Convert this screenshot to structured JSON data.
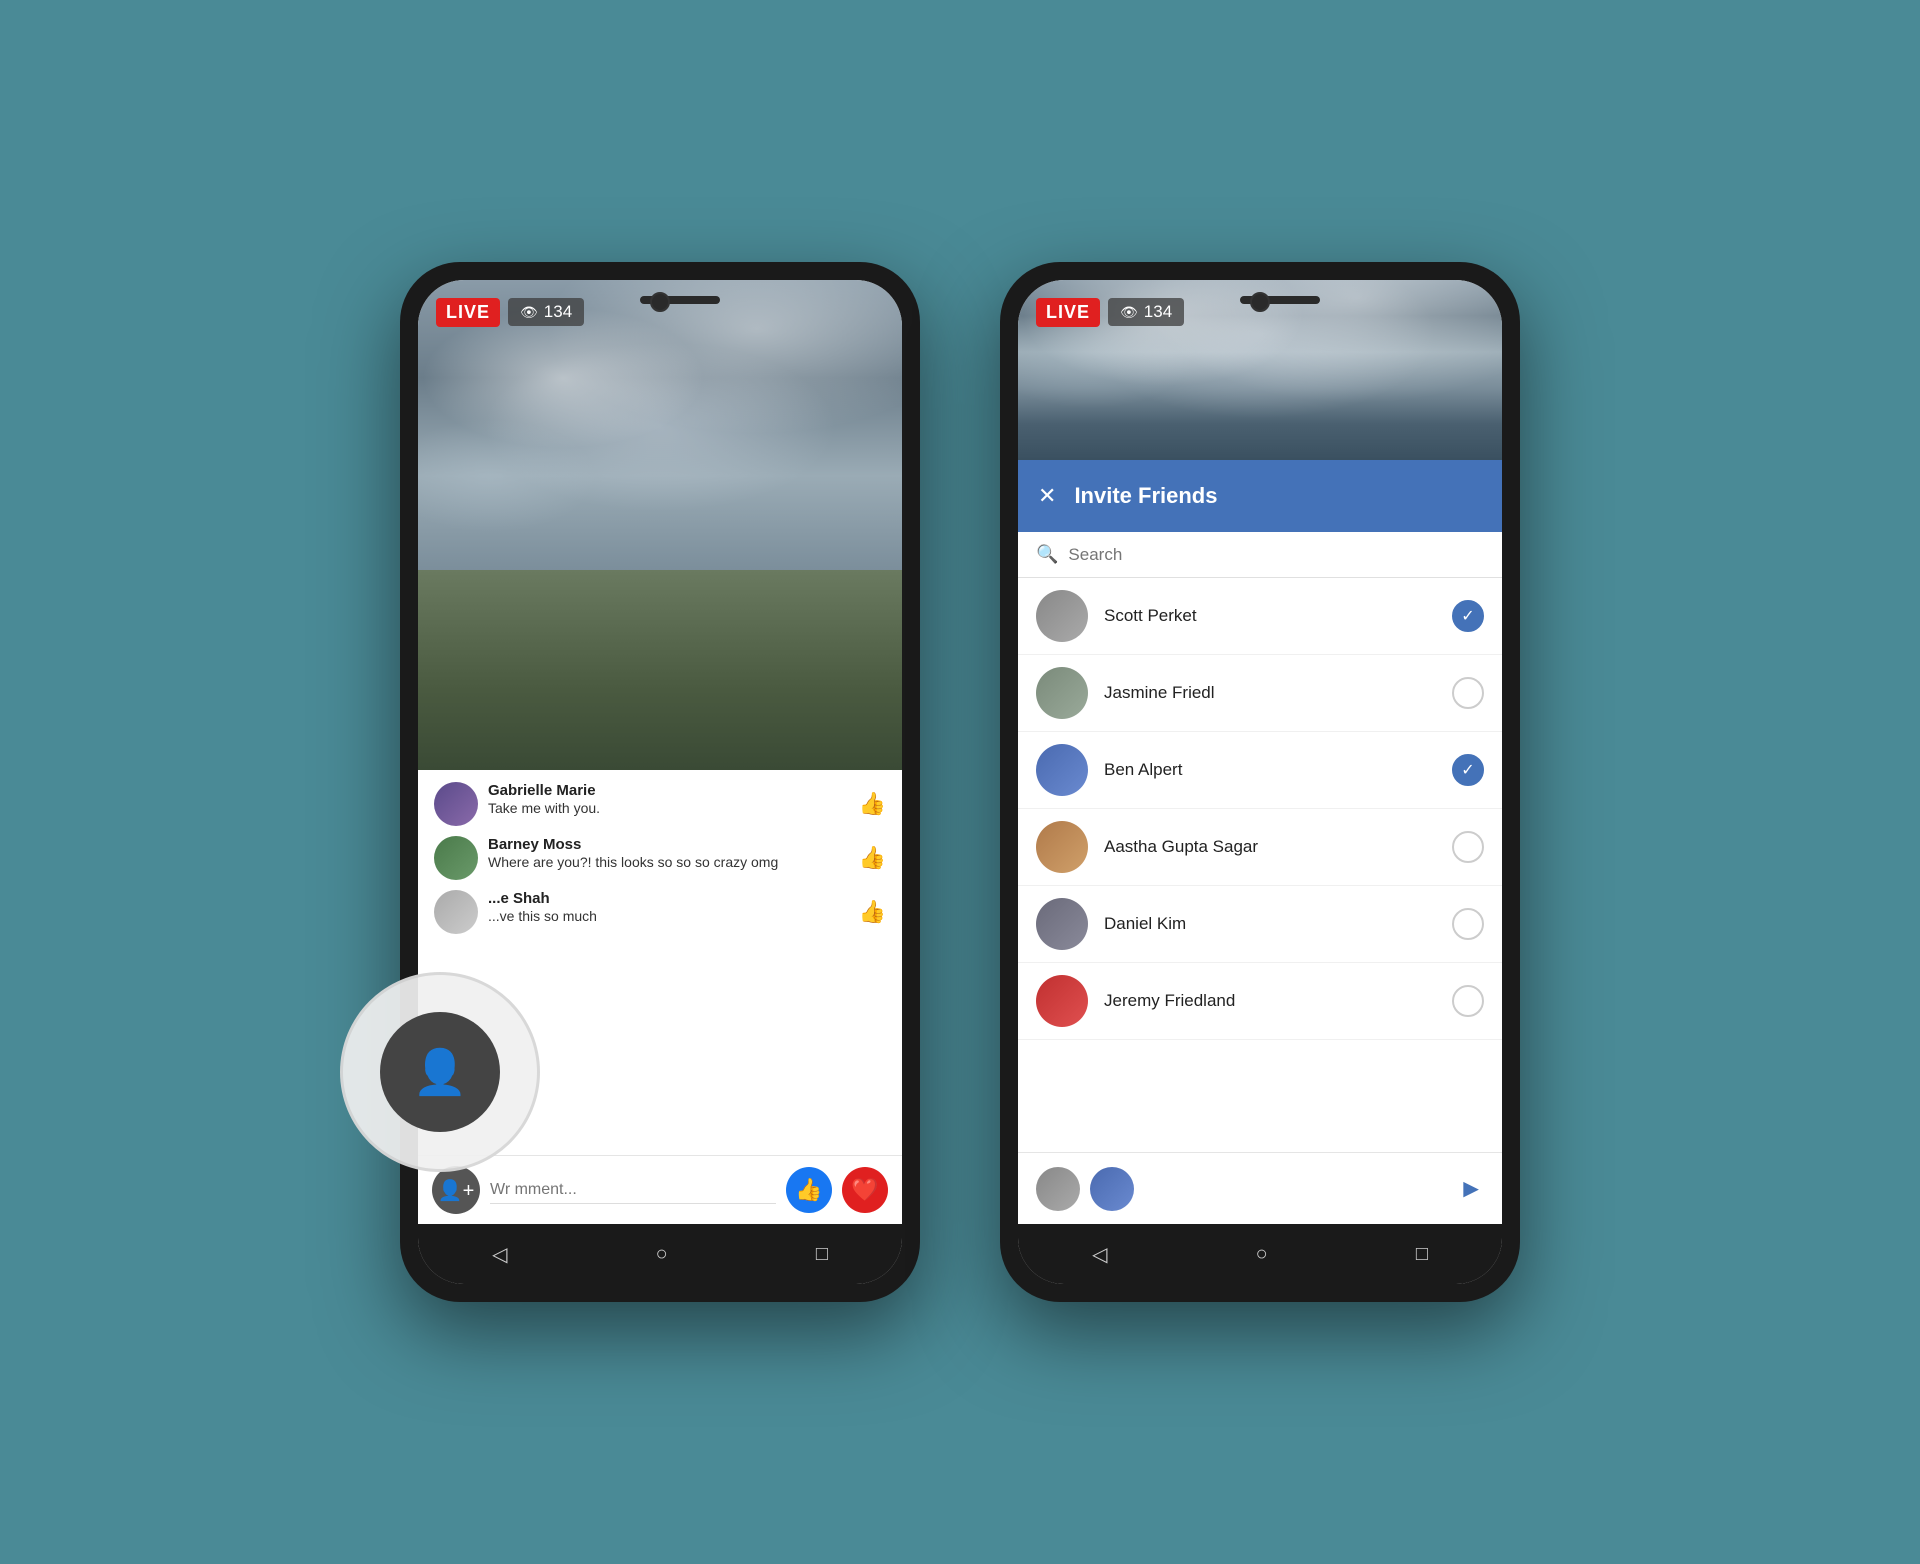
{
  "background_color": "#4a8a96",
  "left_phone": {
    "live_badge": "LIVE",
    "viewer_count": "134",
    "comments": [
      {
        "id": "gabrielle",
        "name": "Gabrielle Marie",
        "text": "Take me with you.",
        "avatar_class": "av-gabrielle"
      },
      {
        "id": "barney",
        "name": "Barney Moss",
        "text": "Where are you?! this looks so so so crazy omg",
        "avatar_class": "av-barney"
      },
      {
        "id": "shah",
        "name": "...e Shah",
        "text": "...ve this so much",
        "avatar_class": "av-shah"
      }
    ],
    "comment_placeholder": "Wr mment...",
    "nav": [
      "◁",
      "○",
      "□"
    ]
  },
  "right_phone": {
    "live_badge": "LIVE",
    "viewer_count": "134",
    "invite_title": "Invite Friends",
    "search_placeholder": "Search",
    "friends": [
      {
        "id": "scott",
        "name": "Scott Perket",
        "avatar_class": "av-scott",
        "checked": true
      },
      {
        "id": "jasmine",
        "name": "Jasmine Friedl",
        "avatar_class": "av-jasmine",
        "checked": false
      },
      {
        "id": "ben",
        "name": "Ben Alpert",
        "avatar_class": "av-ben",
        "checked": true
      },
      {
        "id": "aastha",
        "name": "Aastha Gupta Sagar",
        "avatar_class": "av-aastha",
        "checked": false
      },
      {
        "id": "daniel",
        "name": "Daniel Kim",
        "avatar_class": "av-daniel",
        "checked": false
      },
      {
        "id": "jeremy",
        "name": "Jeremy Friedland",
        "avatar_class": "av-jeremy",
        "checked": false
      }
    ],
    "selected_avatars": [
      "av-scott",
      "av-ben"
    ],
    "nav": [
      "◁",
      "○",
      "□"
    ]
  }
}
